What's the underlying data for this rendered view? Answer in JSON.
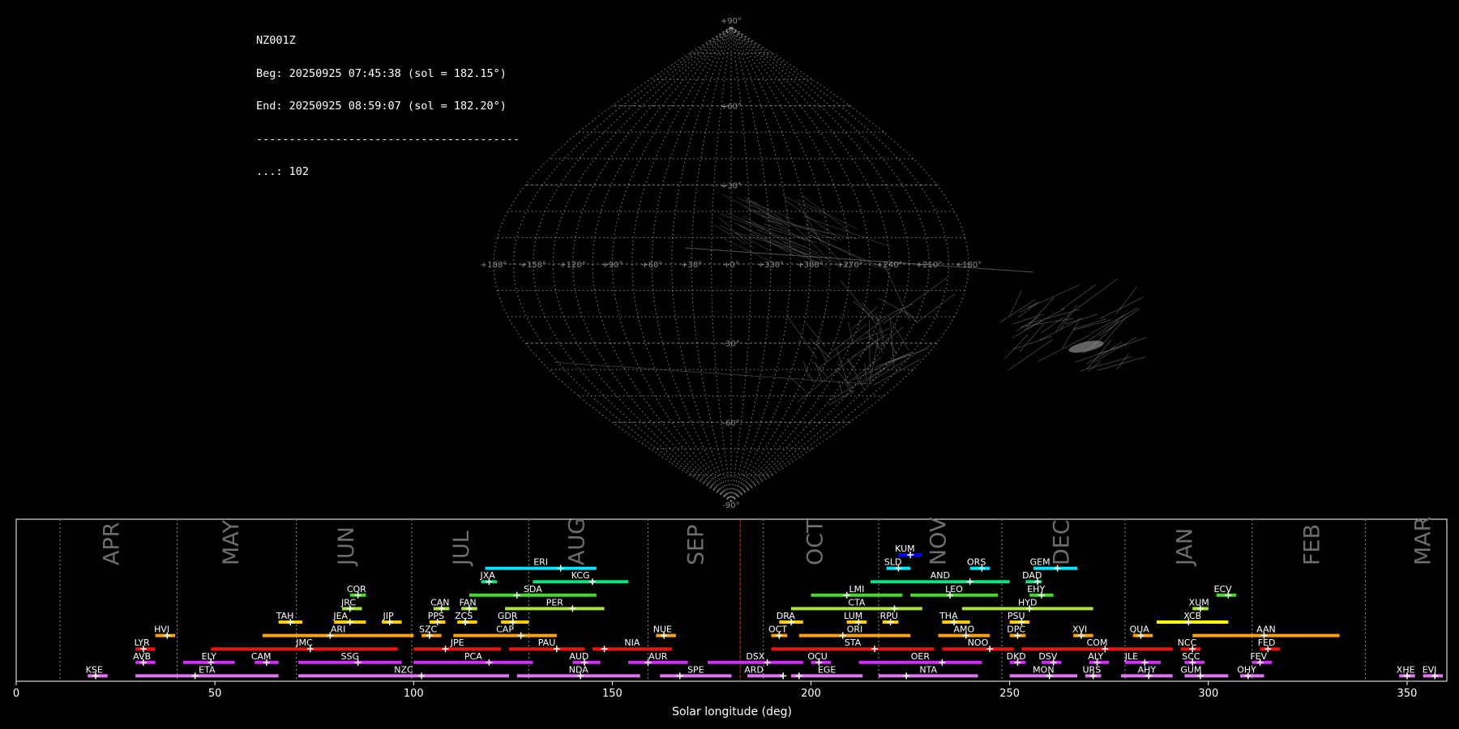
{
  "header": {
    "station": "NZ001Z",
    "begin": "Beg: 20250925 07:45:38 (sol = 182.15°)",
    "end": "End: 20250925 08:59:07 (sol = 182.20°)",
    "separator": "----------------------------------------",
    "count": "...: 102"
  },
  "chart_data": [
    {
      "type": "scatter",
      "subtype": "sinusoidal sky map",
      "lat_ticks": [
        90,
        60,
        30,
        -30,
        -60,
        -90
      ],
      "lon_ticks": [
        180,
        150,
        120,
        90,
        60,
        30,
        0,
        330,
        300,
        270,
        240,
        210,
        180
      ],
      "lat_labels": [
        "+90°",
        "+60°",
        "+30°",
        "-30°",
        "-60°",
        "-90°"
      ],
      "lon_labels": [
        "+180°",
        "+150°",
        "+120°",
        "+90°",
        "+60°",
        "+30°",
        "+0°",
        "+330°",
        "+300°",
        "+270°",
        "+240°",
        "+210°",
        "+180°"
      ],
      "grid": true,
      "colors": {
        "grid": "#9a9a9a",
        "tracks": "#7a7a7a"
      }
    },
    {
      "type": "timeline",
      "xlabel": "Solar longitude (deg)",
      "xlim": [
        0,
        360
      ],
      "xticks": [
        0,
        50,
        100,
        150,
        200,
        250,
        300,
        350
      ],
      "current_sol": 182.2,
      "months": [
        {
          "label": "APR",
          "at": 24
        },
        {
          "label": "MAY",
          "at": 54
        },
        {
          "label": "JUN",
          "at": 83
        },
        {
          "label": "JUL",
          "at": 112
        },
        {
          "label": "AUG",
          "at": 141
        },
        {
          "label": "SEP",
          "at": 171
        },
        {
          "label": "OCT",
          "at": 201
        },
        {
          "label": "NOV",
          "at": 232
        },
        {
          "label": "DEC",
          "at": 263
        },
        {
          "label": "JAN",
          "at": 294
        },
        {
          "label": "FEB",
          "at": 326
        },
        {
          "label": "MAR",
          "at": 354
        }
      ],
      "month_boundaries": [
        11,
        40.5,
        70.5,
        99.5,
        129,
        159,
        188,
        217,
        248,
        279,
        311,
        339.5
      ],
      "colors": {
        "current": "#ff0000",
        "axis": "#ffffff",
        "month": "#6e6e6e",
        "boundary": "#7a7a7a"
      },
      "showers": [
        {
          "code": "KUM",
          "start": 222,
          "end": 228,
          "peak": 225,
          "row": 0,
          "color": "#0000ff"
        },
        {
          "code": "ERI",
          "start": 118,
          "end": 146,
          "peak": 137,
          "row": 1,
          "color": "#00e5ff"
        },
        {
          "code": "SLD",
          "start": 219,
          "end": 225,
          "peak": 222,
          "row": 1,
          "color": "#00e5ff"
        },
        {
          "code": "ORS",
          "start": 240,
          "end": 245,
          "peak": 243,
          "row": 1,
          "color": "#00e5ff"
        },
        {
          "code": "GEM",
          "start": 256,
          "end": 267,
          "peak": 262,
          "row": 1,
          "color": "#00e5ff"
        },
        {
          "code": "JXA",
          "start": 117,
          "end": 121,
          "peak": 119,
          "row": 2,
          "color": "#00e87a"
        },
        {
          "code": "KCG",
          "start": 130,
          "end": 154,
          "peak": 145,
          "row": 2,
          "color": "#00e87a"
        },
        {
          "code": "AND",
          "start": 215,
          "end": 250,
          "peak": 240,
          "row": 2,
          "color": "#00e87a"
        },
        {
          "code": "DAD",
          "start": 254,
          "end": 258,
          "peak": 257,
          "row": 2,
          "color": "#00e87a"
        },
        {
          "code": "COR",
          "start": 84,
          "end": 88,
          "peak": 86,
          "row": 3,
          "color": "#44dd22"
        },
        {
          "code": "SDA",
          "start": 114,
          "end": 146,
          "peak": 126,
          "row": 3,
          "color": "#44dd22"
        },
        {
          "code": "LMI",
          "start": 200,
          "end": 223,
          "peak": 209,
          "row": 3,
          "color": "#44dd22"
        },
        {
          "code": "LEO",
          "start": 225,
          "end": 247,
          "peak": 235,
          "row": 3,
          "color": "#44dd22"
        },
        {
          "code": "EHY",
          "start": 255,
          "end": 261,
          "peak": 258,
          "row": 3,
          "color": "#44dd22"
        },
        {
          "code": "ECV",
          "start": 302,
          "end": 307,
          "peak": 305,
          "row": 3,
          "color": "#44dd22"
        },
        {
          "code": "JRC",
          "start": 82,
          "end": 87,
          "peak": 84,
          "row": 4,
          "color": "#a6e833"
        },
        {
          "code": "CAN",
          "start": 105,
          "end": 109,
          "peak": 107,
          "row": 4,
          "color": "#a6e833"
        },
        {
          "code": "FAN",
          "start": 112,
          "end": 116,
          "peak": 114,
          "row": 4,
          "color": "#a6e833"
        },
        {
          "code": "PER",
          "start": 123,
          "end": 148,
          "peak": 140,
          "row": 4,
          "color": "#a6e833"
        },
        {
          "code": "CTA",
          "start": 195,
          "end": 228,
          "peak": 221,
          "row": 4,
          "color": "#a6e833"
        },
        {
          "code": "HYD",
          "start": 238,
          "end": 271,
          "peak": 255,
          "row": 4,
          "color": "#a6e833"
        },
        {
          "code": "XUM",
          "start": 296,
          "end": 300,
          "peak": 298,
          "row": 4,
          "color": "#a6e833"
        },
        {
          "code": "TAH",
          "start": 66,
          "end": 72,
          "peak": 69,
          "row": 5,
          "color": "#ffcc00"
        },
        {
          "code": "JEA",
          "start": 80,
          "end": 88,
          "peak": 84,
          "row": 5,
          "color": "#ffcc00"
        },
        {
          "code": "JIP",
          "start": 92,
          "end": 97,
          "peak": 94,
          "row": 5,
          "color": "#ffcc00"
        },
        {
          "code": "PPS",
          "start": 104,
          "end": 108,
          "peak": 106,
          "row": 5,
          "color": "#ffcc00"
        },
        {
          "code": "ZCS",
          "start": 111,
          "end": 116,
          "peak": 113,
          "row": 5,
          "color": "#ffcc00"
        },
        {
          "code": "GDR",
          "start": 122,
          "end": 129,
          "peak": 125,
          "row": 5,
          "color": "#ffcc00"
        },
        {
          "code": "DRA",
          "start": 192,
          "end": 198,
          "peak": 195,
          "row": 5,
          "color": "#ffcc00"
        },
        {
          "code": "LUM",
          "start": 209,
          "end": 214,
          "peak": 212,
          "row": 5,
          "color": "#ffcc00"
        },
        {
          "code": "RPU",
          "start": 218,
          "end": 222,
          "peak": 220,
          "row": 5,
          "color": "#ffcc00"
        },
        {
          "code": "THA",
          "start": 233,
          "end": 240,
          "peak": 236,
          "row": 5,
          "color": "#ffcc00"
        },
        {
          "code": "PSU",
          "start": 250,
          "end": 255,
          "peak": 253,
          "row": 5,
          "color": "#ffcc00"
        },
        {
          "code": "XCB",
          "start": 287,
          "end": 305,
          "peak": 295,
          "row": 5,
          "color": "#ffff00"
        },
        {
          "code": "HVI",
          "start": 35,
          "end": 40,
          "peak": 38,
          "row": 6,
          "color": "#ffa500"
        },
        {
          "code": "ARI",
          "start": 62,
          "end": 100,
          "peak": 79,
          "row": 6,
          "color": "#ffa500"
        },
        {
          "code": "SZC",
          "start": 102,
          "end": 107,
          "peak": 104,
          "row": 6,
          "color": "#ffa500"
        },
        {
          "code": "CAP",
          "start": 110,
          "end": 136,
          "peak": 127,
          "row": 6,
          "color": "#ffa500"
        },
        {
          "code": "NUE",
          "start": 161,
          "end": 166,
          "peak": 163,
          "row": 6,
          "color": "#ffa500"
        },
        {
          "code": "OCT",
          "start": 190,
          "end": 194,
          "peak": 192,
          "row": 6,
          "color": "#ffa500"
        },
        {
          "code": "ORI",
          "start": 197,
          "end": 225,
          "peak": 208,
          "row": 6,
          "color": "#ffa500"
        },
        {
          "code": "AMO",
          "start": 232,
          "end": 245,
          "peak": 239,
          "row": 6,
          "color": "#ffa500"
        },
        {
          "code": "DPC",
          "start": 250,
          "end": 254,
          "peak": 252,
          "row": 6,
          "color": "#ffa500"
        },
        {
          "code": "XVI",
          "start": 266,
          "end": 271,
          "peak": 268,
          "row": 6,
          "color": "#ffa500"
        },
        {
          "code": "QUA",
          "start": 281,
          "end": 286,
          "peak": 283,
          "row": 6,
          "color": "#ffa500"
        },
        {
          "code": "AAN",
          "start": 296,
          "end": 333,
          "peak": 314,
          "row": 6,
          "color": "#ffa500"
        },
        {
          "code": "LYR",
          "start": 30,
          "end": 35,
          "peak": 32,
          "row": 7,
          "color": "#ee1111"
        },
        {
          "code": "JMC",
          "start": 49,
          "end": 96,
          "peak": 74,
          "row": 7,
          "color": "#ee1111"
        },
        {
          "code": "JPE",
          "start": 100,
          "end": 122,
          "peak": 108,
          "row": 7,
          "color": "#ee1111"
        },
        {
          "code": "PAU",
          "start": 124,
          "end": 143,
          "peak": 136,
          "row": 7,
          "color": "#ee1111"
        },
        {
          "code": "NIA",
          "start": 145,
          "end": 165,
          "peak": 148,
          "row": 7,
          "color": "#ee1111"
        },
        {
          "code": "STA",
          "start": 190,
          "end": 231,
          "peak": 216,
          "row": 7,
          "color": "#ee1111"
        },
        {
          "code": "NOO",
          "start": 233,
          "end": 251,
          "peak": 245,
          "row": 7,
          "color": "#ee1111"
        },
        {
          "code": "COM",
          "start": 253,
          "end": 291,
          "peak": 274,
          "row": 7,
          "color": "#ee1111"
        },
        {
          "code": "NCC",
          "start": 293,
          "end": 298,
          "peak": 296,
          "row": 7,
          "color": "#ee1111"
        },
        {
          "code": "FED",
          "start": 313,
          "end": 318,
          "peak": 315,
          "row": 7,
          "color": "#ee1111"
        },
        {
          "code": "AVB",
          "start": 30,
          "end": 35,
          "peak": 32,
          "row": 8,
          "color": "#cc33ee"
        },
        {
          "code": "ELY",
          "start": 42,
          "end": 55,
          "peak": 49,
          "row": 8,
          "color": "#cc33ee"
        },
        {
          "code": "CAM",
          "start": 60,
          "end": 66,
          "peak": 63,
          "row": 8,
          "color": "#cc33ee"
        },
        {
          "code": "SSG",
          "start": 71,
          "end": 97,
          "peak": 86,
          "row": 8,
          "color": "#cc33ee"
        },
        {
          "code": "PCA",
          "start": 100,
          "end": 130,
          "peak": 119,
          "row": 8,
          "color": "#cc33ee"
        },
        {
          "code": "AUD",
          "start": 140,
          "end": 147,
          "peak": 143,
          "row": 8,
          "color": "#cc33ee"
        },
        {
          "code": "AUR",
          "start": 154,
          "end": 169,
          "peak": 159,
          "row": 8,
          "color": "#cc33ee"
        },
        {
          "code": "DSX",
          "start": 174,
          "end": 198,
          "peak": 189,
          "row": 8,
          "color": "#cc33ee"
        },
        {
          "code": "OCU",
          "start": 200,
          "end": 205,
          "peak": 202,
          "row": 8,
          "color": "#cc33ee"
        },
        {
          "code": "OER",
          "start": 212,
          "end": 243,
          "peak": 233,
          "row": 8,
          "color": "#cc33ee"
        },
        {
          "code": "DKD",
          "start": 250,
          "end": 254,
          "peak": 252,
          "row": 8,
          "color": "#cc33ee"
        },
        {
          "code": "DSV",
          "start": 258,
          "end": 263,
          "peak": 261,
          "row": 8,
          "color": "#cc33ee"
        },
        {
          "code": "ALY",
          "start": 270,
          "end": 275,
          "peak": 272,
          "row": 8,
          "color": "#cc33ee"
        },
        {
          "code": "JLE",
          "start": 279,
          "end": 288,
          "peak": 284,
          "row": 8,
          "color": "#cc33ee"
        },
        {
          "code": "SCC",
          "start": 294,
          "end": 299,
          "peak": 296,
          "row": 8,
          "color": "#cc33ee"
        },
        {
          "code": "FEV",
          "start": 311,
          "end": 316,
          "peak": 313,
          "row": 8,
          "color": "#cc33ee"
        },
        {
          "code": "KSE",
          "start": 18,
          "end": 23,
          "peak": 20,
          "row": 9,
          "color": "#dd77ee"
        },
        {
          "code": "ETA",
          "start": 30,
          "end": 66,
          "peak": 45,
          "row": 9,
          "color": "#dd77ee"
        },
        {
          "code": "NZC",
          "start": 71,
          "end": 124,
          "peak": 102,
          "row": 9,
          "color": "#dd77ee"
        },
        {
          "code": "NDA",
          "start": 126,
          "end": 157,
          "peak": 142,
          "row": 9,
          "color": "#dd77ee"
        },
        {
          "code": "SPE",
          "start": 162,
          "end": 180,
          "peak": 167,
          "row": 9,
          "color": "#dd77ee"
        },
        {
          "code": "ARD",
          "start": 184,
          "end": 193,
          "peak": 193,
          "row": 9,
          "color": "#dd77ee"
        },
        {
          "code": "EGE",
          "start": 195,
          "end": 213,
          "peak": 197,
          "row": 9,
          "color": "#dd77ee"
        },
        {
          "code": "NTA",
          "start": 217,
          "end": 242,
          "peak": 224,
          "row": 9,
          "color": "#dd77ee"
        },
        {
          "code": "MON",
          "start": 250,
          "end": 267,
          "peak": 260,
          "row": 9,
          "color": "#dd77ee"
        },
        {
          "code": "URS",
          "start": 269,
          "end": 273,
          "peak": 271,
          "row": 9,
          "color": "#dd77ee"
        },
        {
          "code": "AHY",
          "start": 278,
          "end": 291,
          "peak": 285,
          "row": 9,
          "color": "#dd77ee"
        },
        {
          "code": "GUM",
          "start": 294,
          "end": 305,
          "peak": 298,
          "row": 9,
          "color": "#dd77ee"
        },
        {
          "code": "OHY",
          "start": 308,
          "end": 314,
          "peak": 310,
          "row": 9,
          "color": "#dd77ee"
        },
        {
          "code": "XHE",
          "start": 348,
          "end": 352,
          "peak": 350,
          "row": 9,
          "color": "#dd77ee"
        },
        {
          "code": "EVI",
          "start": 354,
          "end": 359,
          "peak": 357,
          "row": 9,
          "color": "#dd77ee"
        }
      ]
    }
  ]
}
